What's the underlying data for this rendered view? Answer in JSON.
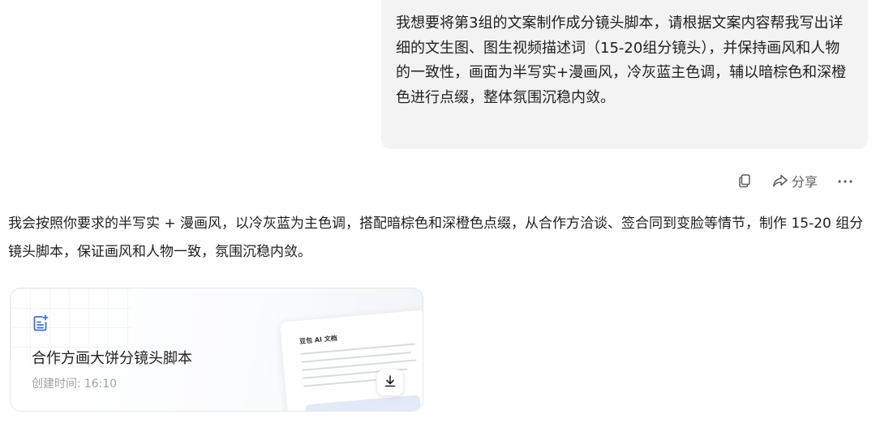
{
  "user_message": {
    "text": "我想要将第3组的文案制作成分镜头脚本，请根据文案内容帮我写出详细的文生图、图生视频描述词（15-20组分镜头），并保持画风和人物的一致性，画面为半写实+漫画风，冷灰蓝主色调，辅以暗棕色和深橙色进行点缀，整体氛围沉稳内敛。"
  },
  "message_actions": {
    "copy_icon": "copy-icon",
    "share_label": "分享",
    "more_icon": "more-icon"
  },
  "assistant_reply": {
    "text": "我会按照你要求的半写实 + 漫画风，以冷灰蓝为主色调，搭配暗棕色和深橙色点缀，从合作方洽谈、签合同到变脸等情节，制作 15-20 组分镜头脚本，保证画风和人物一致，氛围沉稳内敛。"
  },
  "document_card": {
    "title": "合作方画大饼分镜头脚本",
    "created_label": "创建时间:",
    "created_time": "16:10",
    "preview_title": "豆包 AI 文档",
    "accent_color": "#3b6ee8"
  }
}
